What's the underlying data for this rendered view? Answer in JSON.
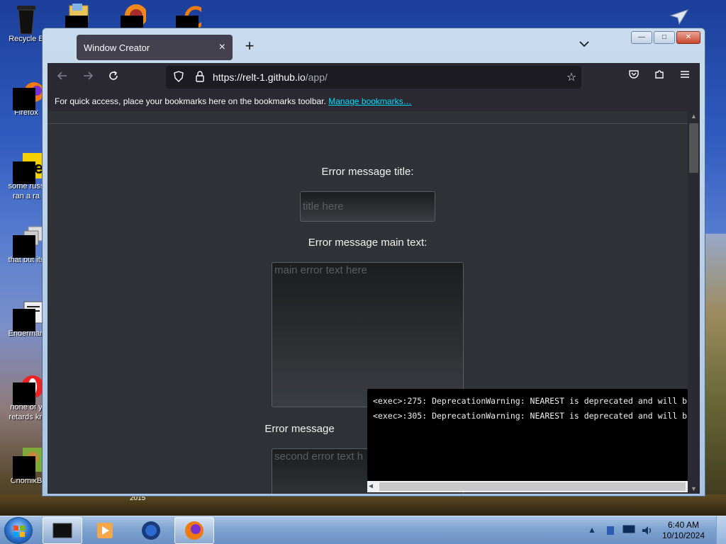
{
  "desktop": {
    "icons": [
      {
        "label": "Recycle B"
      },
      {
        "label": "Firefox"
      },
      {
        "label": "some russ\nran a ra"
      },
      {
        "label": "that but its"
      },
      {
        "label": "Enderman"
      },
      {
        "label": "none of y\nretards kn"
      },
      {
        "label": "ChomikB"
      }
    ],
    "wallpaper_label": "2015"
  },
  "browser": {
    "tab_title": "Window Creator",
    "tab_close": "×",
    "new_tab": "+",
    "list_tabs": "⌄",
    "window_buttons": {
      "minimize": "—",
      "maximize": "□",
      "close": "✕"
    },
    "url_domain": "https://relt-1.github.io",
    "url_path": "/app/",
    "bookmarks_text": "For quick access, place your bookmarks here on the bookmarks toolbar.",
    "bookmarks_link": "Manage bookmarks…"
  },
  "page": {
    "title_label": "Error message title:",
    "title_placeholder": "title here",
    "main_label": "Error message main text:",
    "main_placeholder": "main error text here",
    "second_label": "Error message",
    "second_placeholder": "second error text h"
  },
  "console": {
    "lines": [
      "<exec>:275: DeprecationWarning: NEAREST is deprecated and will b",
      "<exec>:305: DeprecationWarning: NEAREST is deprecated and will b"
    ]
  },
  "taskbar": {
    "time": "6:40 AM",
    "date": "10/10/2024"
  },
  "colors": {
    "browser_chrome": "#2b2a33",
    "page_bg": "#2f3236",
    "link": "#00ddff",
    "console_bg": "#000000"
  }
}
